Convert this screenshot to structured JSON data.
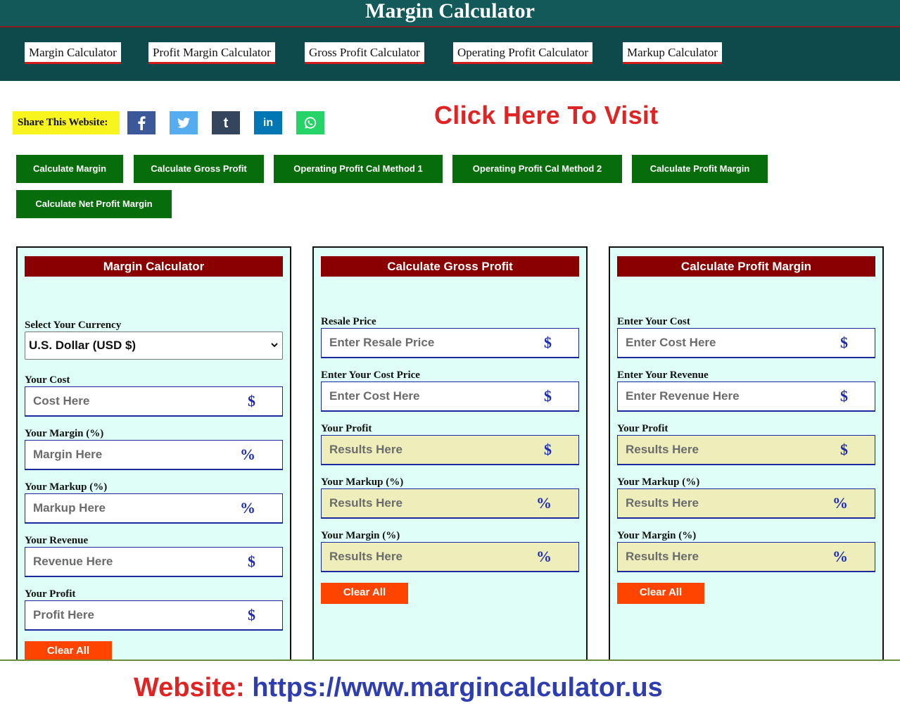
{
  "site": {
    "title": "Margin Calculator"
  },
  "nav": [
    "Margin Calculator",
    "Profit Margin Calculator",
    "Gross Profit Calculator",
    "Operating Profit Calculator",
    "Markup Calculator"
  ],
  "share": {
    "label": "Share This Website:",
    "icons": [
      {
        "name": "facebook-icon",
        "color": "#3b5998"
      },
      {
        "name": "twitter-icon",
        "color": "#55acee"
      },
      {
        "name": "tumblr-icon",
        "color": "#35465c"
      },
      {
        "name": "linkedin-icon",
        "color": "#0077b5"
      },
      {
        "name": "whatsapp-icon",
        "color": "#25d366"
      }
    ]
  },
  "visit_link": "Click Here To Visit",
  "calc_buttons": [
    "Calculate Margin",
    "Calculate Gross Profit",
    "Operating Profit Cal Method 1",
    "Operating Profit Cal Method 2",
    "Calculate Profit Margin",
    "Calculate Net Profit Margin"
  ],
  "colors": {
    "header": "#0e4a4c",
    "panel_bg": "#dffef7",
    "panel_head": "#8a0000",
    "button_green": "#066d0a",
    "clear_button": "#ff4400",
    "accent_red": "#e02424",
    "url_blue": "#2e3db0"
  },
  "panels": [
    {
      "title": "Margin Calculator",
      "currency": {
        "label": "Select Your Currency",
        "selected": "U.S. Dollar (USD $)"
      },
      "fields": [
        {
          "label": "Your Cost",
          "placeholder": "Cost Here",
          "unit": "$"
        },
        {
          "label": "Your Margin (%)",
          "placeholder": "Margin Here",
          "unit": "%"
        },
        {
          "label": "Your Markup (%)",
          "placeholder": "Markup Here",
          "unit": "%"
        },
        {
          "label": "Your Revenue",
          "placeholder": "Revenue Here",
          "unit": "$"
        },
        {
          "label": "Your Profit",
          "placeholder": "Profit Here",
          "unit": "$"
        }
      ],
      "clear_label": "Clear All"
    },
    {
      "title": "Calculate Gross Profit",
      "fields": [
        {
          "label": "Resale Price",
          "placeholder": "Enter Resale Price",
          "unit": "$"
        },
        {
          "label": "Enter Your Cost Price",
          "placeholder": "Enter Cost Here",
          "unit": "$"
        },
        {
          "label": "Your Profit",
          "placeholder": "Results Here",
          "unit": "$"
        },
        {
          "label": "Your Markup (%)",
          "placeholder": "Results Here",
          "unit": "%"
        },
        {
          "label": "Your Margin (%)",
          "placeholder": "Results Here",
          "unit": "%"
        }
      ],
      "clear_label": "Clear All"
    },
    {
      "title": "Calculate Profit Margin",
      "fields": [
        {
          "label": "Enter Your Cost",
          "placeholder": "Enter Cost Here",
          "unit": "$"
        },
        {
          "label": "Enter Your Revenue",
          "placeholder": "Enter Revenue Here",
          "unit": "$"
        },
        {
          "label": "Your Profit",
          "placeholder": "Results Here",
          "unit": "$"
        },
        {
          "label": "Your Markup (%)",
          "placeholder": "Results Here",
          "unit": "%"
        },
        {
          "label": "Your Margin (%)",
          "placeholder": "Results Here",
          "unit": "%"
        }
      ],
      "clear_label": "Clear All"
    }
  ],
  "footer": {
    "label": "Website:",
    "url": "https://www.margincalculator.us"
  }
}
